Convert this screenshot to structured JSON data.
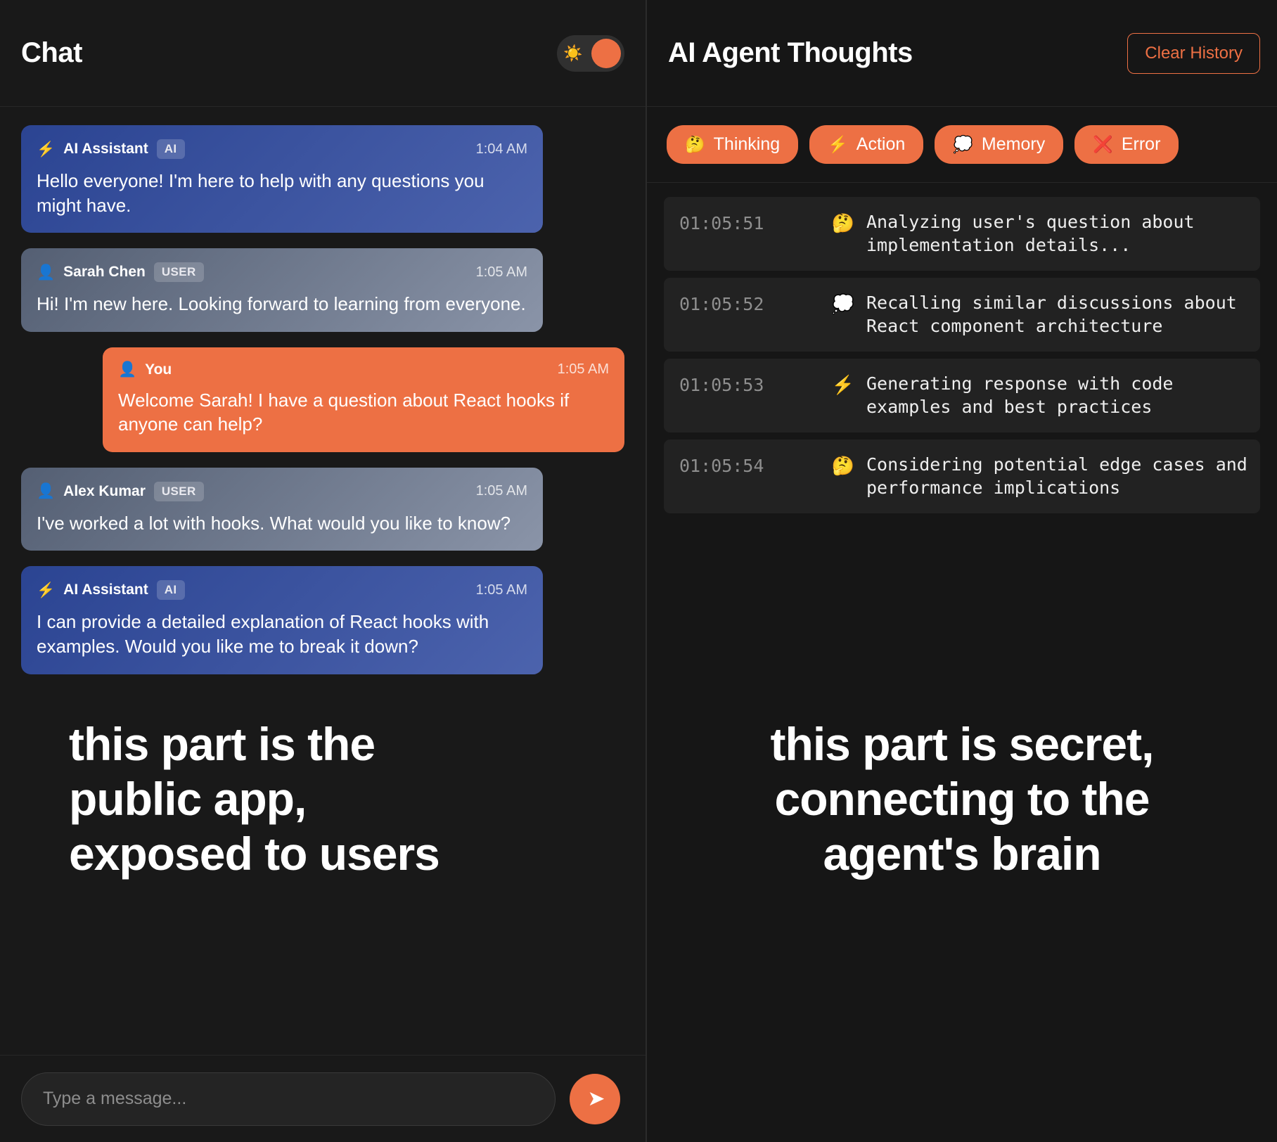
{
  "left": {
    "title": "Chat",
    "theme_toggle": {
      "icon": "sun-icon",
      "glyph": "☀️"
    },
    "messages": [
      {
        "icon": "⚡",
        "icon_name": "lightning-icon",
        "name": "AI Assistant",
        "badge": "AI",
        "time": "1:04 AM",
        "text": "Hello everyone! I'm here to help with any questions you might have.",
        "side": "left",
        "kind": "ai"
      },
      {
        "icon": "👤",
        "icon_name": "person-icon",
        "name": "Sarah Chen",
        "badge": "USER",
        "time": "1:05 AM",
        "text": "Hi! I'm new here. Looking forward to learning from everyone.",
        "side": "left",
        "kind": "user"
      },
      {
        "icon": "👤",
        "icon_name": "person-icon",
        "name": "You",
        "badge": "",
        "time": "1:05 AM",
        "text": "Welcome Sarah! I have a question about React hooks if anyone can help?",
        "side": "right",
        "kind": "you"
      },
      {
        "icon": "👤",
        "icon_name": "person-icon",
        "name": "Alex Kumar",
        "badge": "USER",
        "time": "1:05 AM",
        "text": "I've worked a lot with hooks. What would you like to know?",
        "side": "left",
        "kind": "user"
      },
      {
        "icon": "⚡",
        "icon_name": "lightning-icon",
        "name": "AI Assistant",
        "badge": "AI",
        "time": "1:05 AM",
        "text": "I can provide a detailed explanation of React hooks with examples. Would you like me to break it down?",
        "side": "left",
        "kind": "ai"
      }
    ],
    "overlay_note": "this part is the\npublic app,\nexposed to users",
    "composer": {
      "placeholder": "Type a message...",
      "value": "",
      "send_glyph": "➤"
    }
  },
  "right": {
    "title": "AI Agent Thoughts",
    "clear_history_label": "Clear History",
    "filters": [
      {
        "icon": "🤔",
        "icon_name": "thinking-face-icon",
        "label": "Thinking"
      },
      {
        "icon": "⚡",
        "icon_name": "lightning-icon",
        "label": "Action"
      },
      {
        "icon": "💭",
        "icon_name": "thought-balloon-icon",
        "label": "Memory"
      },
      {
        "icon": "❌",
        "icon_name": "cross-mark-icon",
        "label": "Error"
      }
    ],
    "thoughts": [
      {
        "time": "01:05:51",
        "icon": "🤔",
        "icon_name": "thinking-face-icon",
        "text": "Analyzing user's question about implementation details..."
      },
      {
        "time": "01:05:52",
        "icon": "💭",
        "icon_name": "thought-balloon-icon",
        "text": "Recalling similar discussions about React component architecture"
      },
      {
        "time": "01:05:53",
        "icon": "⚡",
        "icon_name": "lightning-icon",
        "text": "Generating response with code examples and best practices"
      },
      {
        "time": "01:05:54",
        "icon": "🤔",
        "icon_name": "thinking-face-icon",
        "text": "Considering potential edge cases and performance implications"
      }
    ],
    "overlay_note": "this part is secret,\nconnecting to the\nagent's brain"
  },
  "colors": {
    "accent": "#ed7044",
    "ai_bubble_start": "#2b4492",
    "ai_bubble_end": "#4c63ad",
    "user_bubble_start": "#545f73",
    "user_bubble_end": "#8a94a8",
    "panel_bg": "#191919",
    "thought_row_bg": "#222222"
  }
}
